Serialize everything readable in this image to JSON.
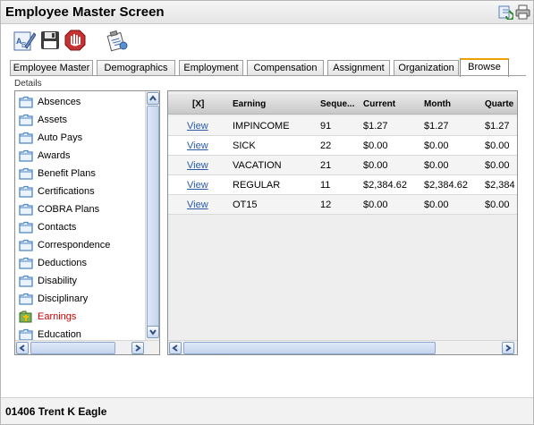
{
  "window": {
    "title": "Employee Master Screen"
  },
  "titlebar_icons": [
    "refresh-icon",
    "print-icon"
  ],
  "toolbar": {
    "tools": [
      {
        "name": "edit-tool-button",
        "icon": "edit-form-icon"
      },
      {
        "name": "save-button",
        "icon": "save-icon"
      },
      {
        "name": "stop-button",
        "icon": "stop-icon"
      },
      {
        "name": "tasks-button",
        "icon": "clipboard-icon"
      }
    ]
  },
  "tabs": [
    {
      "label": "Employee Master",
      "active": false
    },
    {
      "label": "Demographics",
      "active": false
    },
    {
      "label": "Employment",
      "active": false
    },
    {
      "label": "Compensation",
      "active": false
    },
    {
      "label": "Assignment",
      "active": false
    },
    {
      "label": "Organization",
      "active": false
    },
    {
      "label": "Browse",
      "active": true
    }
  ],
  "details": {
    "label": "Details",
    "items": [
      {
        "label": "Absences",
        "selected": false
      },
      {
        "label": "Assets",
        "selected": false
      },
      {
        "label": "Auto Pays",
        "selected": false
      },
      {
        "label": "Awards",
        "selected": false
      },
      {
        "label": "Benefit Plans",
        "selected": false
      },
      {
        "label": "Certifications",
        "selected": false
      },
      {
        "label": "COBRA Plans",
        "selected": false
      },
      {
        "label": "Contacts",
        "selected": false
      },
      {
        "label": "Correspondence",
        "selected": false
      },
      {
        "label": "Deductions",
        "selected": false
      },
      {
        "label": "Disability",
        "selected": false
      },
      {
        "label": "Disciplinary",
        "selected": false
      },
      {
        "label": "Earnings",
        "selected": true
      },
      {
        "label": "Education",
        "selected": false
      }
    ]
  },
  "grid": {
    "columns": [
      "[X]",
      "Earning",
      "Seque...",
      "Current",
      "Month",
      "Quarte"
    ],
    "rows": [
      {
        "action": "View",
        "earning": "IMPINCOME",
        "sequence": "91",
        "current": "$1.27",
        "month": "$1.27",
        "quarter": "$1.27"
      },
      {
        "action": "View",
        "earning": "SICK",
        "sequence": "22",
        "current": "$0.00",
        "month": "$0.00",
        "quarter": "$0.00"
      },
      {
        "action": "View",
        "earning": "VACATION",
        "sequence": "21",
        "current": "$0.00",
        "month": "$0.00",
        "quarter": "$0.00"
      },
      {
        "action": "View",
        "earning": "REGULAR",
        "sequence": "11",
        "current": "$2,384.62",
        "month": "$2,384.62",
        "quarter": "$2,384"
      },
      {
        "action": "View",
        "earning": "OT15",
        "sequence": "12",
        "current": "$0.00",
        "month": "$0.00",
        "quarter": "$0.00"
      }
    ]
  },
  "footer": {
    "employee": "01406 Trent K Eagle"
  },
  "colors": {
    "selected_item": "#d40000",
    "link": "#2b5ba8",
    "active_tab_accent": "#f0a000",
    "folder": "#4f86c6"
  }
}
